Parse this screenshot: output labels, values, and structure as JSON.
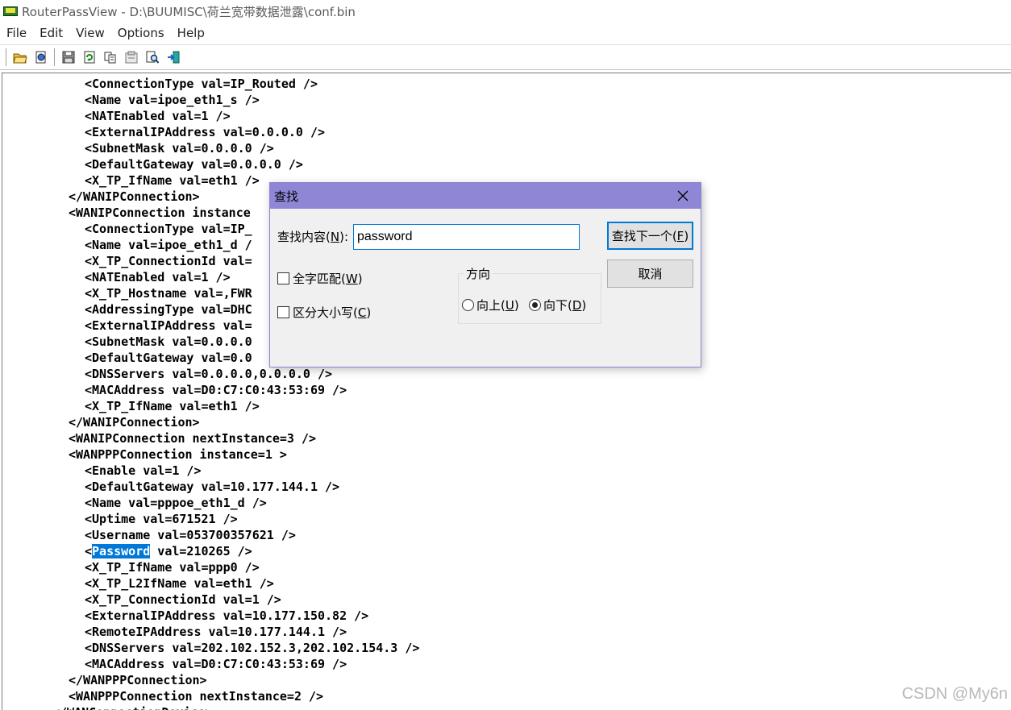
{
  "window": {
    "title": "RouterPassView  -  D:\\BUUMISC\\荷兰宽带数据泄露\\conf.bin"
  },
  "menu": [
    "File",
    "Edit",
    "View",
    "Options",
    "Help"
  ],
  "toolbar": [
    "open-folder-icon",
    "open-file-icon",
    "save-icon",
    "refresh-icon",
    "copy-icon",
    "properties-icon",
    "find-icon",
    "exit-icon"
  ],
  "editor": {
    "lines": [
      {
        "indent": 6,
        "text": "<ConnectionType val=IP_Routed />"
      },
      {
        "indent": 6,
        "text": "<Name val=ipoe_eth1_s />"
      },
      {
        "indent": 6,
        "text": "<NATEnabled val=1 />"
      },
      {
        "indent": 6,
        "text": "<ExternalIPAddress val=0.0.0.0 />"
      },
      {
        "indent": 6,
        "text": "<SubnetMask val=0.0.0.0 />"
      },
      {
        "indent": 6,
        "text": "<DefaultGateway val=0.0.0.0 />"
      },
      {
        "indent": 6,
        "text": "<X_TP_IfName val=eth1 />"
      },
      {
        "indent": 4,
        "text": "</WANIPConnection>"
      },
      {
        "indent": 4,
        "text": "<WANIPConnection instance"
      },
      {
        "indent": 6,
        "text": "<ConnectionType val=IP_"
      },
      {
        "indent": 6,
        "text": "<Name val=ipoe_eth1_d /"
      },
      {
        "indent": 6,
        "text": "<X_TP_ConnectionId val="
      },
      {
        "indent": 6,
        "text": "<NATEnabled val=1 />"
      },
      {
        "indent": 6,
        "text": "<X_TP_Hostname val=,FWR"
      },
      {
        "indent": 6,
        "text": "<AddressingType val=DHC"
      },
      {
        "indent": 6,
        "text": "<ExternalIPAddress val="
      },
      {
        "indent": 6,
        "text": "<SubnetMask val=0.0.0.0"
      },
      {
        "indent": 6,
        "text": "<DefaultGateway val=0.0"
      },
      {
        "indent": 6,
        "text": "<DNSServers val=0.0.0.0,0.0.0.0 />"
      },
      {
        "indent": 6,
        "text": "<MACAddress val=D0:C7:C0:43:53:69 />"
      },
      {
        "indent": 6,
        "text": "<X_TP_IfName val=eth1 />"
      },
      {
        "indent": 4,
        "text": "</WANIPConnection>"
      },
      {
        "indent": 4,
        "text": "<WANIPConnection nextInstance=3 />"
      },
      {
        "indent": 4,
        "text": "<WANPPPConnection instance=1 >"
      },
      {
        "indent": 6,
        "text": "<Enable val=1 />"
      },
      {
        "indent": 6,
        "text": "<DefaultGateway val=10.177.144.1 />"
      },
      {
        "indent": 6,
        "text": "<Name val=pppoe_eth1_d />"
      },
      {
        "indent": 6,
        "text": "<Uptime val=671521 />"
      },
      {
        "indent": 6,
        "text": "<Username val=053700357621 />"
      },
      {
        "indent": 6,
        "pre": "<",
        "hl": "Password",
        "post": " val=210265 />"
      },
      {
        "indent": 6,
        "text": "<X_TP_IfName val=ppp0 />"
      },
      {
        "indent": 6,
        "text": "<X_TP_L2IfName val=eth1 />"
      },
      {
        "indent": 6,
        "text": "<X_TP_ConnectionId val=1 />"
      },
      {
        "indent": 6,
        "text": "<ExternalIPAddress val=10.177.150.82 />"
      },
      {
        "indent": 6,
        "text": "<RemoteIPAddress val=10.177.144.1 />"
      },
      {
        "indent": 6,
        "text": "<DNSServers val=202.102.152.3,202.102.154.3 />"
      },
      {
        "indent": 6,
        "text": "<MACAddress val=D0:C7:C0:43:53:69 />"
      },
      {
        "indent": 4,
        "text": "</WANPPPConnection>"
      },
      {
        "indent": 4,
        "text": "<WANPPPConnection nextInstance=2 />"
      },
      {
        "indent": 2,
        "text": "</WANConnectionDevice>"
      }
    ]
  },
  "find_dialog": {
    "title": "查找",
    "find_label": "查找内容(",
    "find_key": "N",
    "find_label_end": "):",
    "find_value": "password",
    "find_next_label": "查找下一个(",
    "find_next_key": "F",
    "find_next_end": ")",
    "cancel_label": "取消",
    "match_word_label": "全字匹配(",
    "match_word_key": "W",
    "match_word_end": ")",
    "match_case_label": "区分大小写(",
    "match_case_key": "C",
    "match_case_end": ")",
    "direction_label": "方向",
    "up_label": "向上(",
    "up_key": "U",
    "up_end": ")",
    "down_label": "向下(",
    "down_key": "D",
    "down_end": ")",
    "direction_selected": "down"
  },
  "watermark": "CSDN @My6n",
  "colors": {
    "dialog_title": "#8f87d6",
    "highlight": "#0078d7"
  }
}
